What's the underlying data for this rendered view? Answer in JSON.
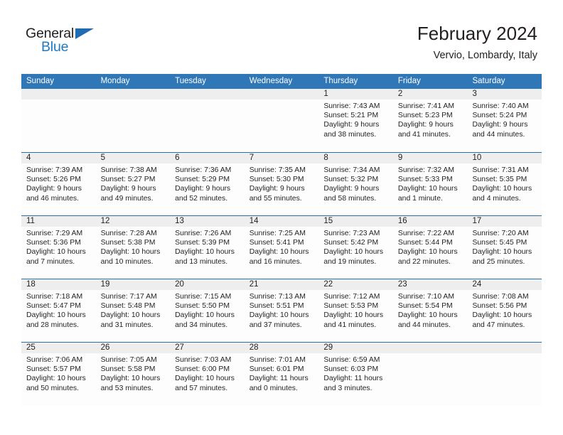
{
  "brand": {
    "name_part1": "General",
    "name_part2": "Blue",
    "logo_icon": "triangle-flag-icon",
    "color_dark": "#231f20",
    "color_blue": "#1f7ac4"
  },
  "header": {
    "title": "February 2024",
    "subtitle": "Vervio, Lombardy, Italy"
  },
  "theme": {
    "header_row_bg": "#3077b8",
    "week_divider": "#2f6fa8",
    "date_band_bg": "#eeeeee",
    "cell_bg": "#fdfdfd",
    "text": "#231f20"
  },
  "calendar": {
    "day_names": [
      "Sunday",
      "Monday",
      "Tuesday",
      "Wednesday",
      "Thursday",
      "Friday",
      "Saturday"
    ],
    "weeks": [
      [
        {
          "date": "",
          "empty": true,
          "sunrise": "",
          "sunset": "",
          "daylight1": "",
          "daylight2": ""
        },
        {
          "date": "",
          "empty": true,
          "sunrise": "",
          "sunset": "",
          "daylight1": "",
          "daylight2": ""
        },
        {
          "date": "",
          "empty": true,
          "sunrise": "",
          "sunset": "",
          "daylight1": "",
          "daylight2": ""
        },
        {
          "date": "",
          "empty": true,
          "sunrise": "",
          "sunset": "",
          "daylight1": "",
          "daylight2": ""
        },
        {
          "date": "1",
          "empty": false,
          "sunrise": "Sunrise: 7:43 AM",
          "sunset": "Sunset: 5:21 PM",
          "daylight1": "Daylight: 9 hours",
          "daylight2": "and 38 minutes."
        },
        {
          "date": "2",
          "empty": false,
          "sunrise": "Sunrise: 7:41 AM",
          "sunset": "Sunset: 5:23 PM",
          "daylight1": "Daylight: 9 hours",
          "daylight2": "and 41 minutes."
        },
        {
          "date": "3",
          "empty": false,
          "sunrise": "Sunrise: 7:40 AM",
          "sunset": "Sunset: 5:24 PM",
          "daylight1": "Daylight: 9 hours",
          "daylight2": "and 44 minutes."
        }
      ],
      [
        {
          "date": "4",
          "empty": false,
          "sunrise": "Sunrise: 7:39 AM",
          "sunset": "Sunset: 5:26 PM",
          "daylight1": "Daylight: 9 hours",
          "daylight2": "and 46 minutes."
        },
        {
          "date": "5",
          "empty": false,
          "sunrise": "Sunrise: 7:38 AM",
          "sunset": "Sunset: 5:27 PM",
          "daylight1": "Daylight: 9 hours",
          "daylight2": "and 49 minutes."
        },
        {
          "date": "6",
          "empty": false,
          "sunrise": "Sunrise: 7:36 AM",
          "sunset": "Sunset: 5:29 PM",
          "daylight1": "Daylight: 9 hours",
          "daylight2": "and 52 minutes."
        },
        {
          "date": "7",
          "empty": false,
          "sunrise": "Sunrise: 7:35 AM",
          "sunset": "Sunset: 5:30 PM",
          "daylight1": "Daylight: 9 hours",
          "daylight2": "and 55 minutes."
        },
        {
          "date": "8",
          "empty": false,
          "sunrise": "Sunrise: 7:34 AM",
          "sunset": "Sunset: 5:32 PM",
          "daylight1": "Daylight: 9 hours",
          "daylight2": "and 58 minutes."
        },
        {
          "date": "9",
          "empty": false,
          "sunrise": "Sunrise: 7:32 AM",
          "sunset": "Sunset: 5:33 PM",
          "daylight1": "Daylight: 10 hours",
          "daylight2": "and 1 minute."
        },
        {
          "date": "10",
          "empty": false,
          "sunrise": "Sunrise: 7:31 AM",
          "sunset": "Sunset: 5:35 PM",
          "daylight1": "Daylight: 10 hours",
          "daylight2": "and 4 minutes."
        }
      ],
      [
        {
          "date": "11",
          "empty": false,
          "sunrise": "Sunrise: 7:29 AM",
          "sunset": "Sunset: 5:36 PM",
          "daylight1": "Daylight: 10 hours",
          "daylight2": "and 7 minutes."
        },
        {
          "date": "12",
          "empty": false,
          "sunrise": "Sunrise: 7:28 AM",
          "sunset": "Sunset: 5:38 PM",
          "daylight1": "Daylight: 10 hours",
          "daylight2": "and 10 minutes."
        },
        {
          "date": "13",
          "empty": false,
          "sunrise": "Sunrise: 7:26 AM",
          "sunset": "Sunset: 5:39 PM",
          "daylight1": "Daylight: 10 hours",
          "daylight2": "and 13 minutes."
        },
        {
          "date": "14",
          "empty": false,
          "sunrise": "Sunrise: 7:25 AM",
          "sunset": "Sunset: 5:41 PM",
          "daylight1": "Daylight: 10 hours",
          "daylight2": "and 16 minutes."
        },
        {
          "date": "15",
          "empty": false,
          "sunrise": "Sunrise: 7:23 AM",
          "sunset": "Sunset: 5:42 PM",
          "daylight1": "Daylight: 10 hours",
          "daylight2": "and 19 minutes."
        },
        {
          "date": "16",
          "empty": false,
          "sunrise": "Sunrise: 7:22 AM",
          "sunset": "Sunset: 5:44 PM",
          "daylight1": "Daylight: 10 hours",
          "daylight2": "and 22 minutes."
        },
        {
          "date": "17",
          "empty": false,
          "sunrise": "Sunrise: 7:20 AM",
          "sunset": "Sunset: 5:45 PM",
          "daylight1": "Daylight: 10 hours",
          "daylight2": "and 25 minutes."
        }
      ],
      [
        {
          "date": "18",
          "empty": false,
          "sunrise": "Sunrise: 7:18 AM",
          "sunset": "Sunset: 5:47 PM",
          "daylight1": "Daylight: 10 hours",
          "daylight2": "and 28 minutes."
        },
        {
          "date": "19",
          "empty": false,
          "sunrise": "Sunrise: 7:17 AM",
          "sunset": "Sunset: 5:48 PM",
          "daylight1": "Daylight: 10 hours",
          "daylight2": "and 31 minutes."
        },
        {
          "date": "20",
          "empty": false,
          "sunrise": "Sunrise: 7:15 AM",
          "sunset": "Sunset: 5:50 PM",
          "daylight1": "Daylight: 10 hours",
          "daylight2": "and 34 minutes."
        },
        {
          "date": "21",
          "empty": false,
          "sunrise": "Sunrise: 7:13 AM",
          "sunset": "Sunset: 5:51 PM",
          "daylight1": "Daylight: 10 hours",
          "daylight2": "and 37 minutes."
        },
        {
          "date": "22",
          "empty": false,
          "sunrise": "Sunrise: 7:12 AM",
          "sunset": "Sunset: 5:53 PM",
          "daylight1": "Daylight: 10 hours",
          "daylight2": "and 41 minutes."
        },
        {
          "date": "23",
          "empty": false,
          "sunrise": "Sunrise: 7:10 AM",
          "sunset": "Sunset: 5:54 PM",
          "daylight1": "Daylight: 10 hours",
          "daylight2": "and 44 minutes."
        },
        {
          "date": "24",
          "empty": false,
          "sunrise": "Sunrise: 7:08 AM",
          "sunset": "Sunset: 5:56 PM",
          "daylight1": "Daylight: 10 hours",
          "daylight2": "and 47 minutes."
        }
      ],
      [
        {
          "date": "25",
          "empty": false,
          "sunrise": "Sunrise: 7:06 AM",
          "sunset": "Sunset: 5:57 PM",
          "daylight1": "Daylight: 10 hours",
          "daylight2": "and 50 minutes."
        },
        {
          "date": "26",
          "empty": false,
          "sunrise": "Sunrise: 7:05 AM",
          "sunset": "Sunset: 5:58 PM",
          "daylight1": "Daylight: 10 hours",
          "daylight2": "and 53 minutes."
        },
        {
          "date": "27",
          "empty": false,
          "sunrise": "Sunrise: 7:03 AM",
          "sunset": "Sunset: 6:00 PM",
          "daylight1": "Daylight: 10 hours",
          "daylight2": "and 57 minutes."
        },
        {
          "date": "28",
          "empty": false,
          "sunrise": "Sunrise: 7:01 AM",
          "sunset": "Sunset: 6:01 PM",
          "daylight1": "Daylight: 11 hours",
          "daylight2": "and 0 minutes."
        },
        {
          "date": "29",
          "empty": false,
          "sunrise": "Sunrise: 6:59 AM",
          "sunset": "Sunset: 6:03 PM",
          "daylight1": "Daylight: 11 hours",
          "daylight2": "and 3 minutes."
        },
        {
          "date": "",
          "empty": true,
          "sunrise": "",
          "sunset": "",
          "daylight1": "",
          "daylight2": ""
        },
        {
          "date": "",
          "empty": true,
          "sunrise": "",
          "sunset": "",
          "daylight1": "",
          "daylight2": ""
        }
      ]
    ]
  }
}
